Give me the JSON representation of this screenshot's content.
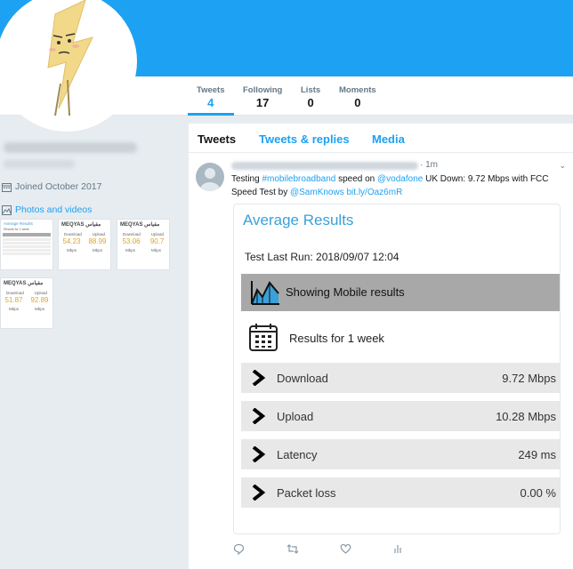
{
  "profile": {
    "joined": "Joined October 2017",
    "photos_link": "Photos and videos"
  },
  "stats": [
    {
      "label": "Tweets",
      "value": "4"
    },
    {
      "label": "Following",
      "value": "17"
    },
    {
      "label": "Lists",
      "value": "0"
    },
    {
      "label": "Moments",
      "value": "0"
    }
  ],
  "timeline_tabs": [
    "Tweets",
    "Tweets & replies",
    "Media"
  ],
  "thumbnails": [
    {
      "brand": "MEQYAS مقياس",
      "download_label": "Download",
      "upload_label": "Upload",
      "download": "54.23",
      "upload": "88.99",
      "unit": "Mbps"
    },
    {
      "brand": "MEQYAS مقياس",
      "download_label": "Download",
      "upload_label": "Upload",
      "download": "53.06",
      "upload": "90.7",
      "unit": "Mbps"
    },
    {
      "brand": "MEQYAS مقياس",
      "download_label": "Download",
      "upload_label": "Upload",
      "download": "51.87",
      "upload": "92.89",
      "unit": "Mbps"
    }
  ],
  "thumbnail_first": {
    "title": "Average Results",
    "subtitle": "Results for 1 week"
  },
  "tweet": {
    "time": "· 1m",
    "text_1": "Testing ",
    "hashtag": "#mobilebroadband",
    "text_2": " speed on ",
    "mention_1": "@vodafone",
    "text_3": " UK Down: 9.72 Mbps with FCC Speed Test by ",
    "mention_2": "@SamKnows",
    "space": " ",
    "link": "bit.ly/Oaz6mR"
  },
  "card": {
    "title": "Average Results",
    "last_run": "Test Last Run: 2018/09/07 12:04",
    "mobile_label": "Showing Mobile results",
    "period_label": "Results for 1 week",
    "metrics": [
      {
        "name": "Download",
        "value": "9.72 Mbps"
      },
      {
        "name": "Upload",
        "value": "10.28 Mbps"
      },
      {
        "name": "Latency",
        "value": "249 ms"
      },
      {
        "name": "Packet loss",
        "value": "0.00 %"
      }
    ]
  },
  "colors": {
    "accent": "#1da1f2",
    "banner": "#1da1f2",
    "card_title": "#3aa0d8",
    "mobile_bar": "#a8a8a8",
    "metric_bg": "#e8e8e8"
  },
  "icons": [
    "calendar-icon",
    "image-icon",
    "reply-icon",
    "retweet-icon",
    "like-icon",
    "analytics-icon",
    "chevron-down-icon",
    "chart-area-icon",
    "arrow-right-icon"
  ]
}
